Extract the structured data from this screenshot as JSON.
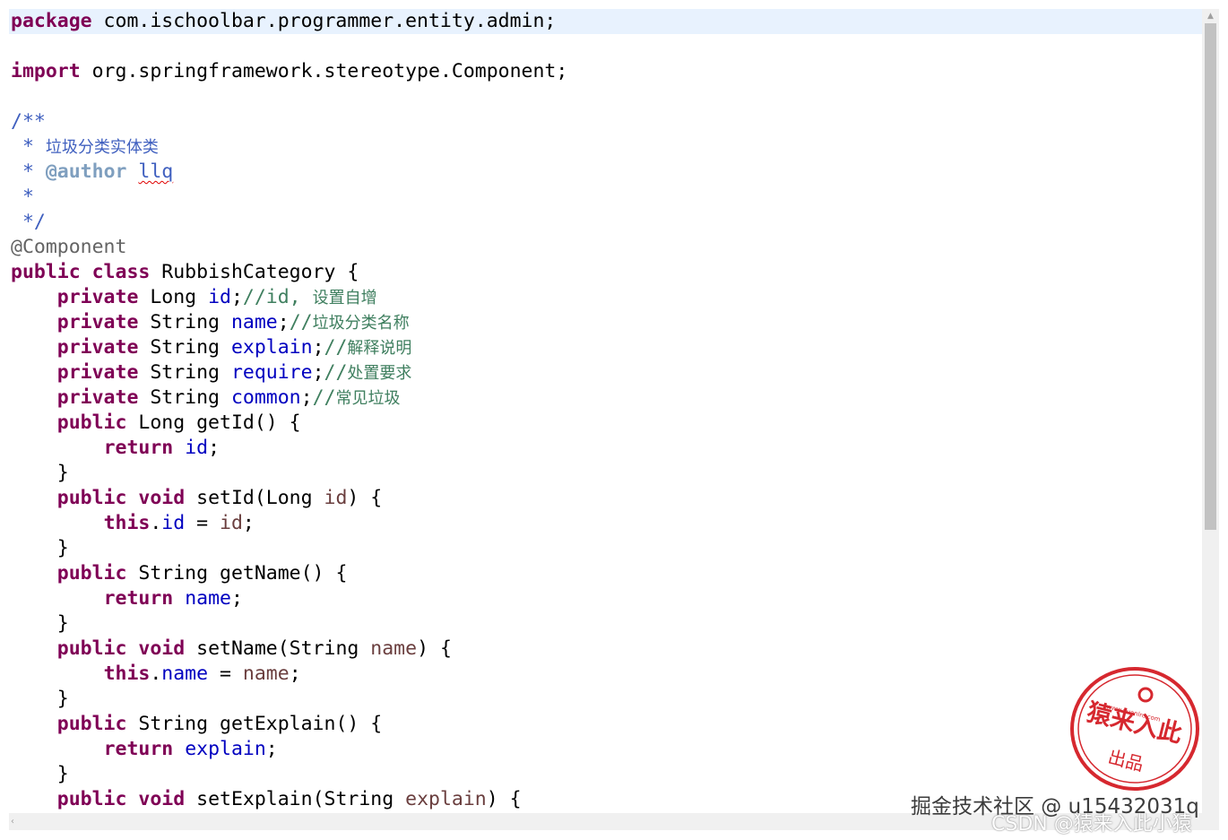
{
  "code": {
    "package_kw": "package",
    "package_name": " com.ischoolbar.programmer.entity.admin;",
    "import_kw": "import",
    "import_name": " org.springframework.stereotype.Component;",
    "doc_open": "/**",
    "doc_star": " * ",
    "doc_desc": "垃圾分类实体类",
    "doc_author_tag": "@author",
    "doc_author_name": "llq",
    "doc_star_only": " *",
    "doc_close": " */",
    "annotation": "@Component",
    "class_kw": "public class",
    "class_name": " RubbishCategory {",
    "kw_private": "private",
    "kw_public": "public",
    "kw_return": "return",
    "kw_this": "this",
    "kw_void": "void",
    "type_long": " Long ",
    "type_string": " String ",
    "field_id": "id",
    "field_name": "name",
    "field_explain": "explain",
    "field_require": "require",
    "field_common": "common",
    "semicolon": ";",
    "comment_slashes": "//",
    "comment_id": "id, ",
    "comment_id_cn": "设置自增",
    "comment_name": "垃圾分类名称",
    "comment_explain": "解释说明",
    "comment_require": "处置要求",
    "comment_common": "常见垃圾",
    "get_id_sig": " Long getId() {",
    "set_id_sig": " setId(Long ",
    "get_name_sig": " String getName() {",
    "set_name_sig": " setName(String ",
    "get_explain_sig": " String getExplain() {",
    "set_explain_sig": " setExplain(String ",
    "sig_close": ") {",
    "assign": " = ",
    "dot": ".",
    "close_brace": "}"
  },
  "watermark": {
    "seal_url": "www.yuanlrc.com",
    "seal_title": "猿来入此",
    "seal_sub": "出品",
    "line1": "掘金技术社区 @ u15432031q",
    "line2": "CSDN @猿来入此小猿"
  },
  "colors": {
    "keyword": "#7f0055",
    "field": "#0000c0",
    "parameter": "#6a3e3e",
    "javadoc": "#3f5fbf",
    "line_comment": "#3f7f5f",
    "annotation": "#646464",
    "current_line": "#e8f2fe",
    "seal": "#d6282f"
  },
  "icons": {
    "scroll_up": "triangle-up-icon",
    "scroll_left": "chevron-left-icon"
  }
}
